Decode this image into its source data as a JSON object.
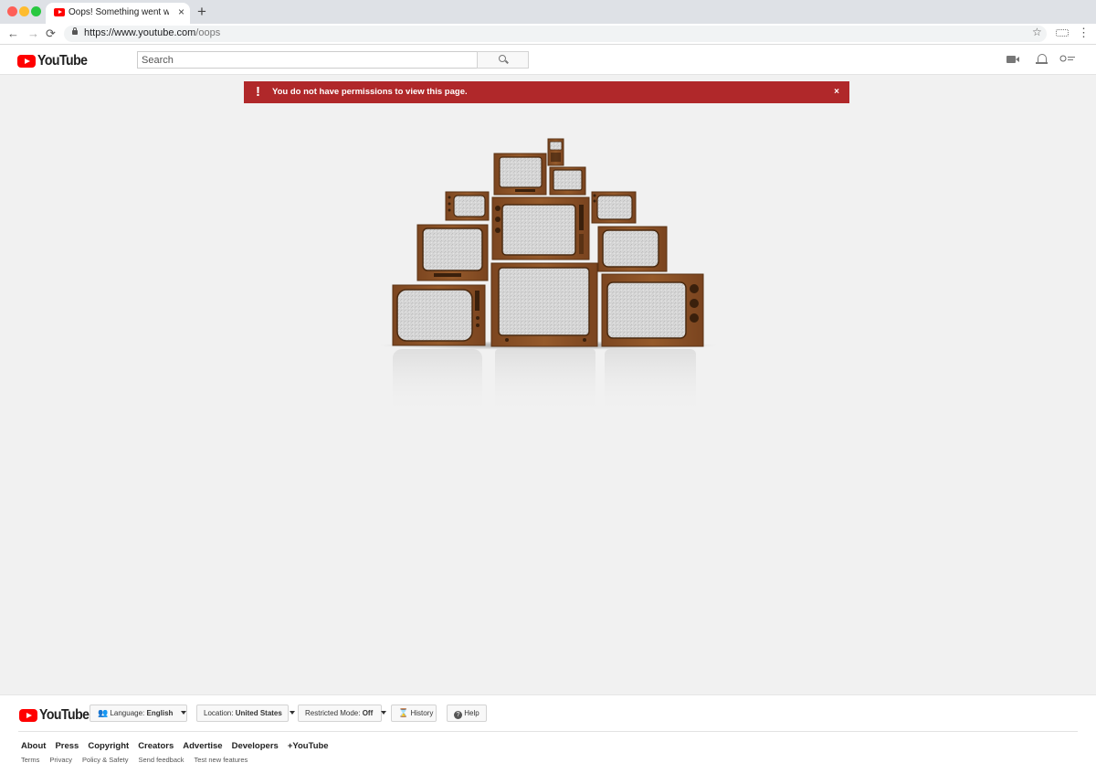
{
  "browser": {
    "tab_title": "Oops! Something went wrong.",
    "tab_close": "×",
    "new_tab": "+",
    "back": "←",
    "forward": "→",
    "reload": "⟳",
    "url_host": "https://www.youtube.com",
    "url_path": "/oops",
    "bookmark_star": "☆",
    "menu": "⋮"
  },
  "header": {
    "logo_text": "YouTube",
    "search_placeholder": "Search"
  },
  "alert": {
    "icon": "!",
    "message": "You do not have permissions to view this page.",
    "close": "×",
    "color": "#b0282a"
  },
  "footer": {
    "logo_text": "YouTube",
    "language_label": "Language:",
    "language_value": "English",
    "location_label": "Location:",
    "location_value": "United States",
    "restricted_label": "Restricted Mode:",
    "restricted_value": "Off",
    "history": "History",
    "help": "Help",
    "links": [
      "About",
      "Press",
      "Copyright",
      "Creators",
      "Advertise",
      "Developers",
      "+YouTube"
    ],
    "sublinks": [
      "Terms",
      "Privacy",
      "Policy & Safety",
      "Send feedback",
      "Test new features"
    ]
  },
  "colors": {
    "brand_red": "#ff0000",
    "page_bg": "#f1f1f1",
    "tv_wood": "#8a5226",
    "tv_screen": "#d9d9d9"
  }
}
